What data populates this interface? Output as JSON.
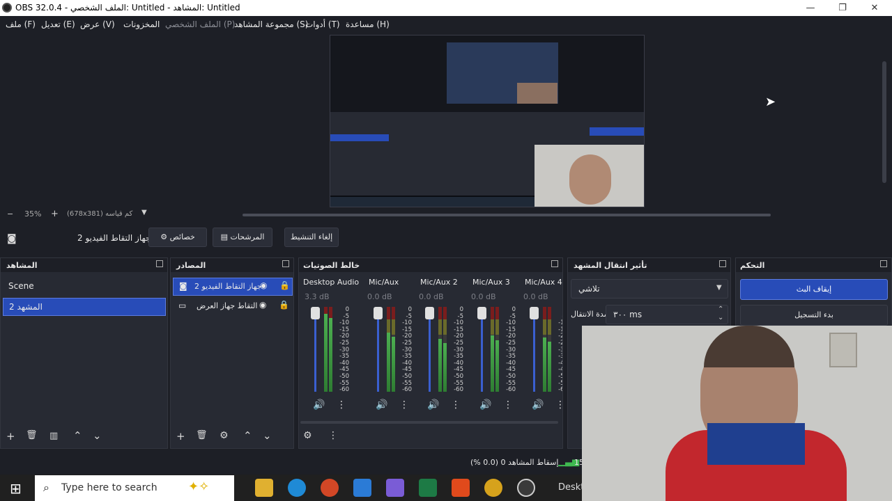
{
  "window": {
    "title": "OBS 32.0.4 - الملف الشخصي: Untitled - المشاهد: Untitled",
    "min": "—",
    "max": "❐",
    "close": "✕"
  },
  "menu": {
    "file": "ملف (F)",
    "edit": "تعديل (E)",
    "view": "عرض (V)",
    "docks": "المخزونات",
    "profile": "الملف الشخصي (P)",
    "scene_collection": "مجموعة المشاهد (S)",
    "tools": "أدوات (T)",
    "help": "مساعدة (H)"
  },
  "zoom": {
    "minus": "−",
    "value": "35%",
    "plus": "+",
    "size": "(678x381) كم قياسه"
  },
  "source_toolbar": {
    "selected_source": "جهاز التقاط الفيديو 2",
    "properties": "خصائص",
    "filters": "المرشحات",
    "deactivate": "إلغاء التنشيط"
  },
  "scenes": {
    "title": "المشاهد",
    "items": [
      "Scene",
      "المشهد 2"
    ]
  },
  "sources": {
    "title": "المصادر",
    "items": [
      "جهاز التقاط الفيديو 2",
      "التقاط جهاز العرض"
    ]
  },
  "mixer": {
    "title": "خالط الصوتيات",
    "channels": [
      {
        "name": "Desktop Audio",
        "db": "3.3 dB"
      },
      {
        "name": "Mic/Aux",
        "db": "0.0 dB"
      },
      {
        "name": "Mic/Aux 2",
        "db": "0.0 dB"
      },
      {
        "name": "Mic/Aux 3",
        "db": "0.0 dB"
      },
      {
        "name": "Mic/Aux 4",
        "db": "0.0 dB"
      }
    ],
    "scale": [
      "0",
      "-5",
      "-10",
      "-15",
      "-20",
      "-25",
      "-30",
      "-35",
      "-40",
      "-45",
      "-50",
      "-55",
      "-60"
    ]
  },
  "transitions": {
    "title": "تأثير انتقال المشهد",
    "selected": "تلاشي",
    "duration_label": "مدة الانتقال",
    "duration": "٣٠٠ ms"
  },
  "controls": {
    "title": "التحكم",
    "stop_stream": "إيقاف البث",
    "start_record": "بدء التسجيل"
  },
  "status": {
    "dropped": "إسقاط المشاهد 0 (0.0 %)",
    "fps": "15"
  },
  "taskbar": {
    "search_placeholder": "Type here to search",
    "desktop": "Deskto"
  },
  "colors": {
    "accent": "#284cb8",
    "background": "#1d1f26",
    "panel": "#272a33"
  }
}
